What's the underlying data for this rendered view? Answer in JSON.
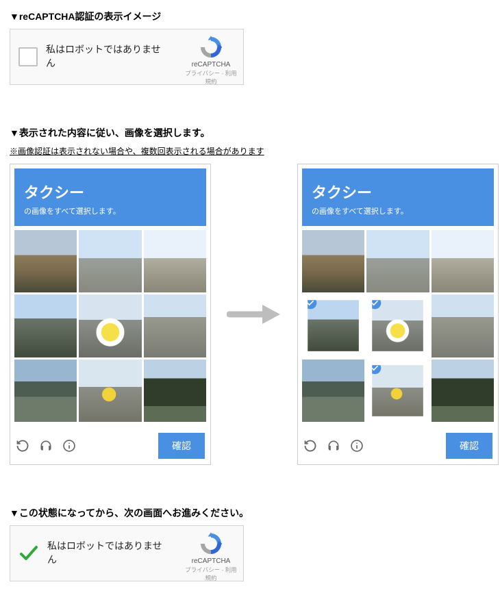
{
  "section1": {
    "heading": "▼reCAPTCHA認証の表示イメージ"
  },
  "anchor": {
    "label": "私はロボットではありません",
    "brand": "reCAPTCHA",
    "links": "プライバシー - 利用規約"
  },
  "section2": {
    "heading": "▼表示された内容に従い、画像を選択します。",
    "subnote": "※画像認証は表示されない場合や、複数回表示される場合があります"
  },
  "challenge": {
    "title": "タクシー",
    "subtitle": "の画像をすべて選択します。",
    "confirm": "確認",
    "tiles": [
      "a",
      "b",
      "c",
      "d",
      "e",
      "f",
      "g",
      "h",
      "i"
    ],
    "selected_right": [
      3,
      4,
      7
    ]
  },
  "section3": {
    "heading": "▼この状態になってから、次の画面へお進みください。"
  }
}
